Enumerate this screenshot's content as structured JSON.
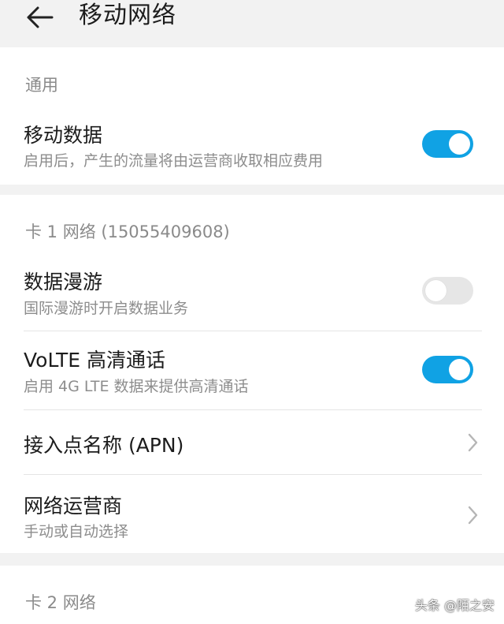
{
  "header": {
    "title": "移动网络",
    "back_icon": "arrow-left-icon"
  },
  "general": {
    "section_title": "通用",
    "mobile_data": {
      "title": "移动数据",
      "subtitle": "启用后，产生的流量将由运营商收取相应费用",
      "enabled": true
    }
  },
  "sim1": {
    "section_title": "卡 1 网络 (15055409608)",
    "roaming": {
      "title": "数据漫游",
      "subtitle": "国际漫游时开启数据业务",
      "enabled": false
    },
    "volte": {
      "title": "VoLTE 高清通话",
      "subtitle": "启用 4G LTE 数据来提供高清通话",
      "enabled": true
    },
    "apn": {
      "title": "接入点名称 (APN)"
    },
    "operator": {
      "title": "网络运营商",
      "subtitle": "手动或自动选择"
    }
  },
  "sim2": {
    "section_title": "卡 2 网络"
  },
  "watermark": "头条 @陌之安",
  "colors": {
    "toggle_on": "#10a2e4",
    "toggle_off": "#e6e6e6",
    "page_background": "#f2f2f2",
    "card_background": "#ffffff"
  }
}
